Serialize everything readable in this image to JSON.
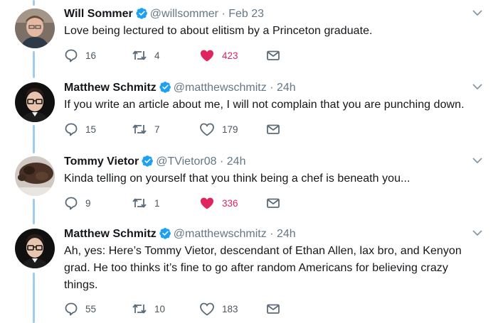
{
  "colors": {
    "accent": "#1da1f2",
    "like": "#e0245e",
    "muted": "#657786",
    "thread_line": "#9fcdf0"
  },
  "tweets": [
    {
      "name": "Will Sommer",
      "handle": "@willsommer",
      "separator": "·",
      "time": "Feb 23",
      "text": "Love being lectured to about elitism by a Princeton graduate.",
      "replies": "16",
      "retweets": "4",
      "likes": "423",
      "liked": true
    },
    {
      "name": "Matthew Schmitz",
      "handle": "@matthewschmitz",
      "separator": "·",
      "time": "24h",
      "text": "If you write an article about me, I will not complain that you are punching down.",
      "replies": "15",
      "retweets": "7",
      "likes": "179",
      "liked": false
    },
    {
      "name": "Tommy Vietor",
      "handle": "@TVietor08",
      "separator": "·",
      "time": "24h",
      "text": "Kinda telling on yourself that you think being a chef is beneath you...",
      "replies": "9",
      "retweets": "1",
      "likes": "336",
      "liked": true
    },
    {
      "name": "Matthew Schmitz",
      "handle": "@matthewschmitz",
      "separator": "·",
      "time": "24h",
      "text": "Ah, yes: Here’s Tommy Vietor, descendant of Ethan Allen, lax bro, and Kenyon grad. He too thinks it’s fine to go after random Americans for believing crazy things.",
      "replies": "55",
      "retweets": "10",
      "likes": "183",
      "liked": false
    }
  ]
}
